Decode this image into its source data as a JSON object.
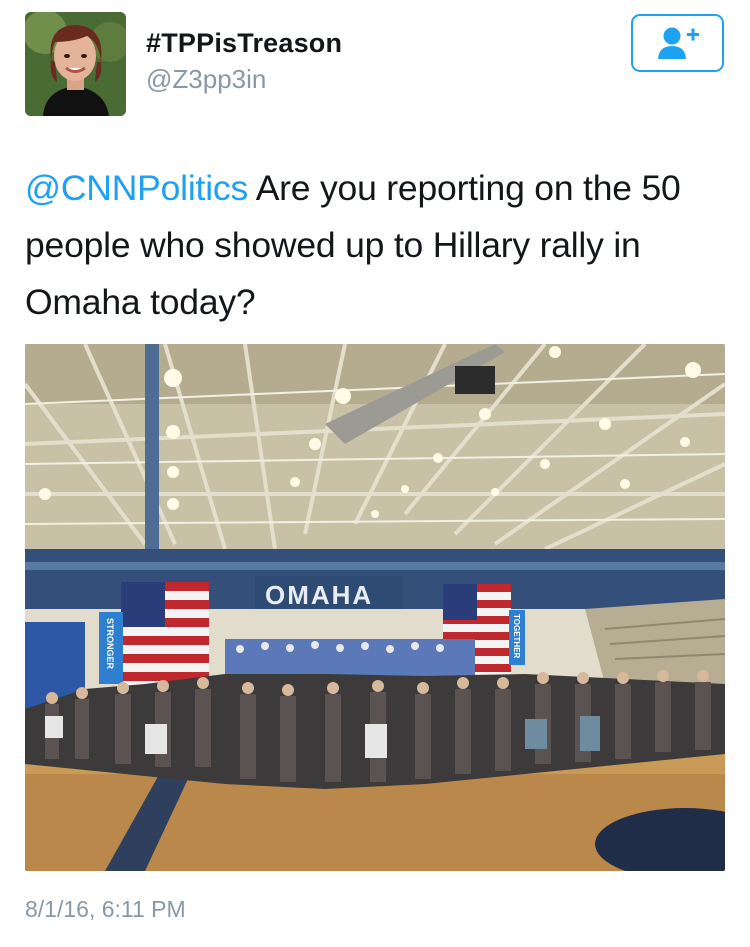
{
  "user": {
    "display_name": "#TPPisTreason",
    "handle": "@Z3pp3in"
  },
  "follow_button": {
    "icon": "add-user-icon"
  },
  "tweet": {
    "mention": "@CNNPolitics",
    "text": " Are you reporting on the 50 people who showed up to Hillary rally in Omaha today?",
    "timestamp": "8/1/16, 6:11 PM"
  },
  "photo": {
    "banner_text": "OMAHA",
    "left_sign_text": "STRONGER",
    "right_sign_text": "TOGETHER"
  },
  "colors": {
    "accent": "#1da1f2",
    "secondary_text": "#8899a6"
  }
}
